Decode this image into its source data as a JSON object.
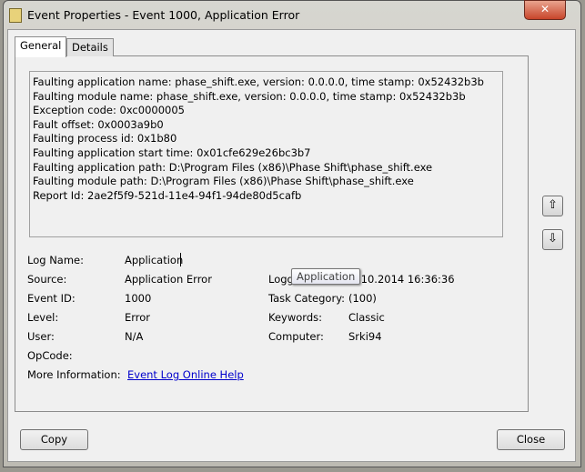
{
  "window": {
    "title": "Event Properties - Event 1000, Application Error",
    "close_glyph": "✕"
  },
  "tabs": [
    {
      "label": "General"
    },
    {
      "label": "Details"
    }
  ],
  "description": "Faulting application name: phase_shift.exe, version: 0.0.0.0, time stamp: 0x52432b3b\nFaulting module name: phase_shift.exe, version: 0.0.0.0, time stamp: 0x52432b3b\nException code: 0xc0000005\nFault offset: 0x0003a9b0\nFaulting process id: 0x1b80\nFaulting application start time: 0x01cfe629e26bc3b7\nFaulting application path: D:\\Program Files (x86)\\Phase Shift\\phase_shift.exe\nFaulting module path: D:\\Program Files (x86)\\Phase Shift\\phase_shift.exe\nReport Id: 2ae2f5f9-521d-11e4-94f1-94de80d5cafb",
  "fields": {
    "log_name": {
      "label": "Log Name:",
      "value": "Application"
    },
    "source": {
      "label": "Source:",
      "value": "Application Error"
    },
    "event_id": {
      "label": "Event ID:",
      "value": "1000"
    },
    "level": {
      "label": "Level:",
      "value": "Error"
    },
    "user": {
      "label": "User:",
      "value": "N/A"
    },
    "opcode": {
      "label": "OpCode:",
      "value": ""
    },
    "more_info": {
      "label": "More Information:",
      "value": "Event Log Online Help"
    },
    "logged": {
      "label": "Logg",
      "value": ".10.2014 16:36:36"
    },
    "task_category": {
      "label": "Task Category:",
      "value": "(100)"
    },
    "keywords": {
      "label": "Keywords:",
      "value": "Classic"
    },
    "computer": {
      "label": "Computer:",
      "value": "Srki94"
    }
  },
  "tooltip": "Application",
  "buttons": {
    "copy": "Copy",
    "close": "Close",
    "up": "⇧",
    "down": "⇩"
  }
}
